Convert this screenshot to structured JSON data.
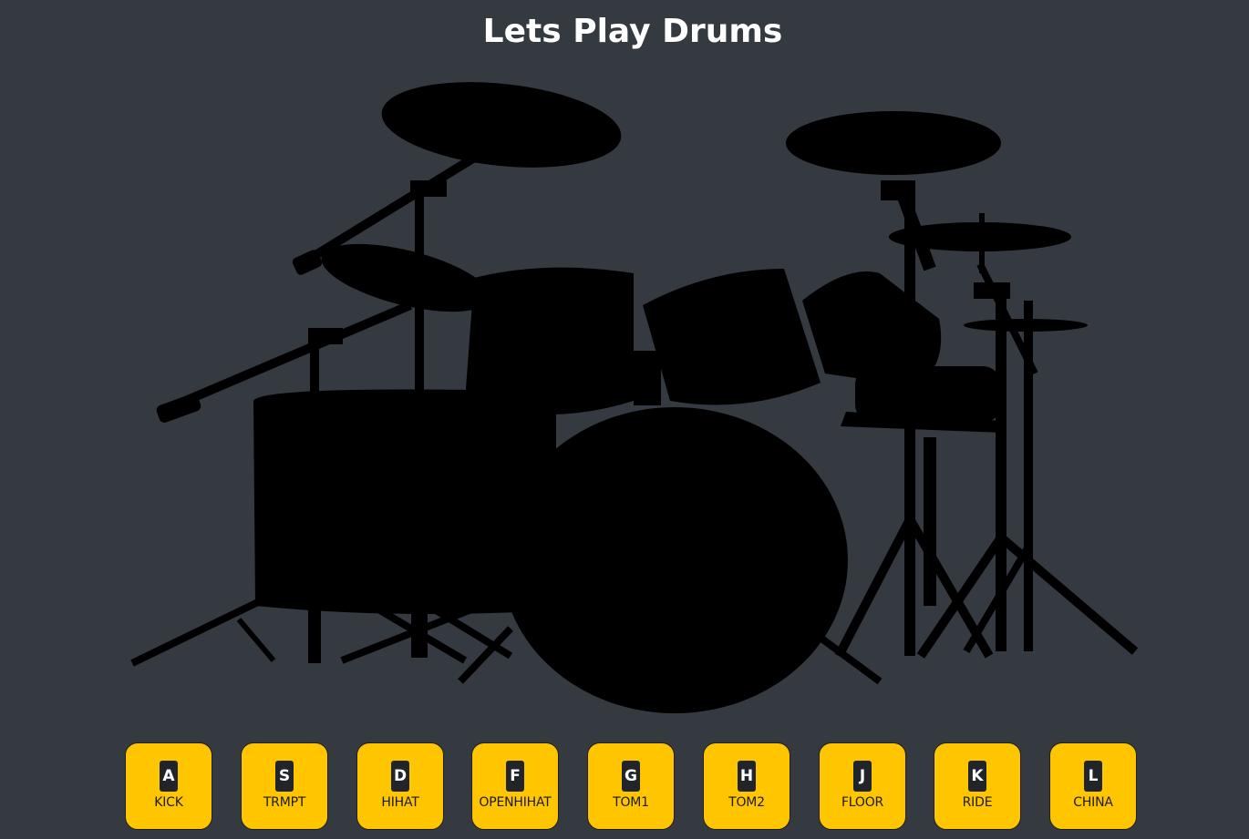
{
  "header": {
    "title": "Lets Play Drums"
  },
  "illustration": {
    "name": "drum-kit-silhouette",
    "color": "#000000"
  },
  "colors": {
    "background": "#343a40",
    "pad": "#ffc600",
    "key_badge": "#212529"
  },
  "pads": [
    {
      "key": "A",
      "label": "KICK"
    },
    {
      "key": "S",
      "label": "TRMPT"
    },
    {
      "key": "D",
      "label": "HIHAT"
    },
    {
      "key": "F",
      "label": "OPENHIHAT"
    },
    {
      "key": "G",
      "label": "TOM1"
    },
    {
      "key": "H",
      "label": "TOM2"
    },
    {
      "key": "J",
      "label": "FLOOR"
    },
    {
      "key": "K",
      "label": "RIDE"
    },
    {
      "key": "L",
      "label": "CHINA"
    }
  ]
}
